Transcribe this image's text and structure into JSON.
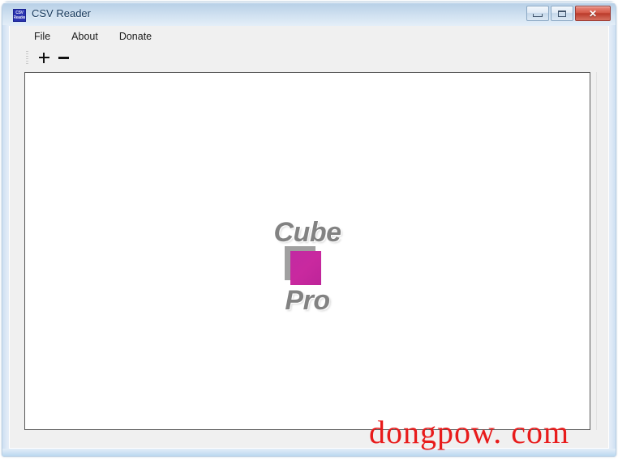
{
  "window": {
    "title": "CSV Reader",
    "icon_name": "app-icon-csv-reader",
    "icon_line1": "CSV",
    "icon_line2": "Reader",
    "controls": {
      "minimize_label": "",
      "maximize_label": "",
      "close_label": "✕"
    }
  },
  "menubar": {
    "items": [
      {
        "label": "File"
      },
      {
        "label": "About"
      },
      {
        "label": "Donate"
      }
    ]
  },
  "toolbar": {
    "buttons": [
      {
        "name": "add-button",
        "label": "+"
      },
      {
        "name": "remove-button",
        "label": "−"
      }
    ]
  },
  "content": {
    "logo": {
      "top_word": "Cube",
      "bottom_word": "Pro",
      "cube_color": "#c2259f",
      "cube_shadow_color": "#a0a0a0",
      "text_color": "#828282"
    }
  },
  "watermark": {
    "text": "dongpow. com",
    "color": "#e81b1b"
  },
  "colors": {
    "titlebar_top": "#b6cfe6",
    "titlebar_bottom": "#e4eef8",
    "client_background": "#f0f0f0",
    "panel_background": "#ffffff",
    "panel_border": "#5a5a5a",
    "close_button": "#bb3c2c"
  }
}
